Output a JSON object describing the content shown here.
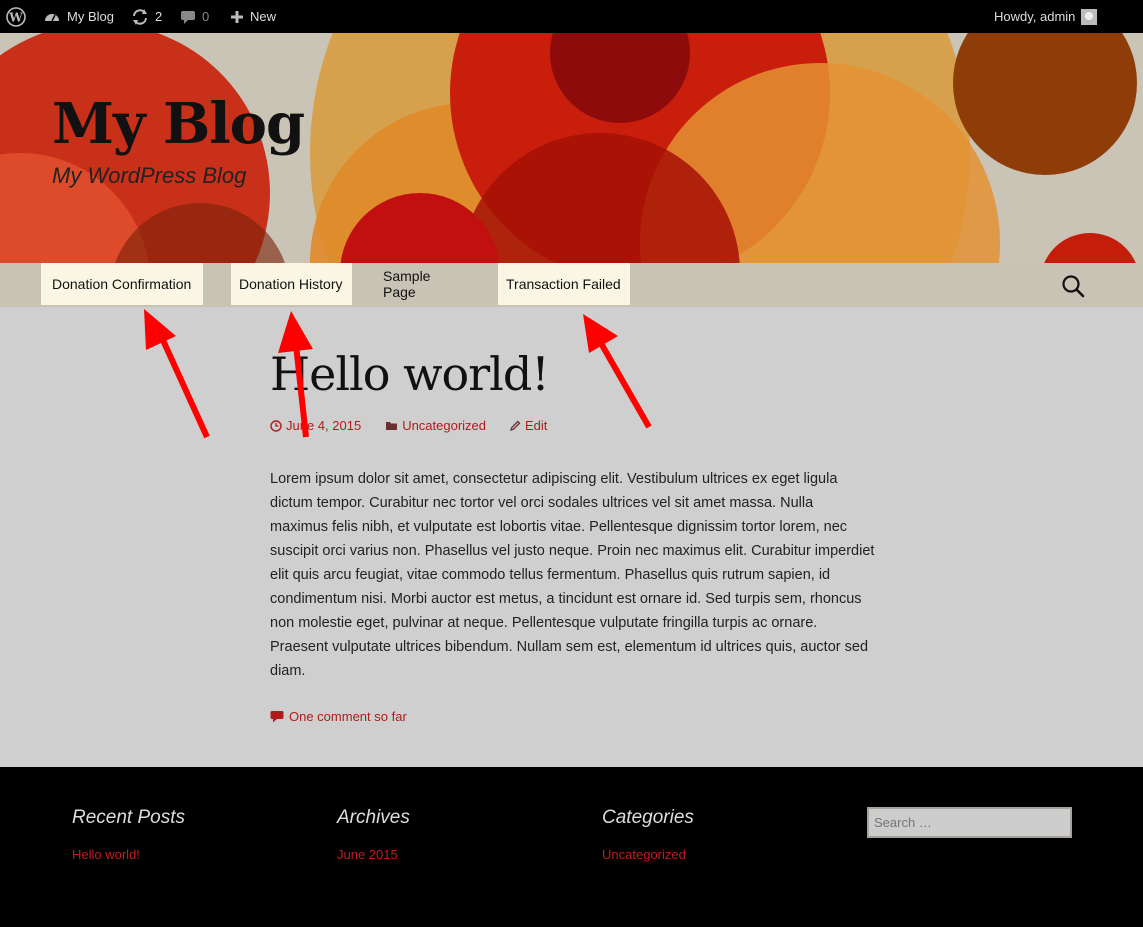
{
  "adminbar": {
    "site_name": "My Blog",
    "updates_count": "2",
    "comments_count": "0",
    "new_label": "New",
    "howdy": "Howdy, admin"
  },
  "header": {
    "title": "My Blog",
    "description": "My WordPress Blog"
  },
  "nav": {
    "items": [
      {
        "label": "Donation Confirmation"
      },
      {
        "label": "Donation History"
      },
      {
        "label": "Sample Page"
      },
      {
        "label": "Transaction Failed"
      }
    ]
  },
  "post": {
    "title": "Hello world!",
    "date": "June 4, 2015",
    "category": "Uncategorized",
    "edit": "Edit",
    "body": "Lorem ipsum dolor sit amet, consectetur adipiscing elit. Vestibulum ultrices ex eget ligula dictum tempor. Curabitur nec tortor vel orci sodales ultrices vel sit amet massa. Nulla maximus felis nibh, et vulputate est lobortis vitae. Pellentesque dignissim tortor lorem, nec suscipit orci varius non. Phasellus vel justo neque. Proin nec maximus elit. Curabitur imperdiet elit quis arcu feugiat, vitae commodo tellus fermentum. Phasellus quis rutrum sapien, id condimentum nisi. Morbi auctor est metus, a tincidunt est ornare id. Sed turpis sem, rhoncus non molestie eget, pulvinar at neque. Pellentesque vulputate fringilla turpis ac ornare. Praesent vulputate ultrices bibendum. Nullam sem est, elementum id ultrices quis, auctor sed diam.",
    "comments": "One comment so far"
  },
  "footer": {
    "recent_posts": {
      "title": "Recent Posts",
      "link": "Hello world!"
    },
    "archives": {
      "title": "Archives",
      "link": "June 2015"
    },
    "categories": {
      "title": "Categories",
      "link": "Uncategorized"
    },
    "search_placeholder": "Search …"
  },
  "colors": {
    "accent": "#c41c1c",
    "nav_highlight": "#faf6e4",
    "arrow": "#ff0000"
  }
}
